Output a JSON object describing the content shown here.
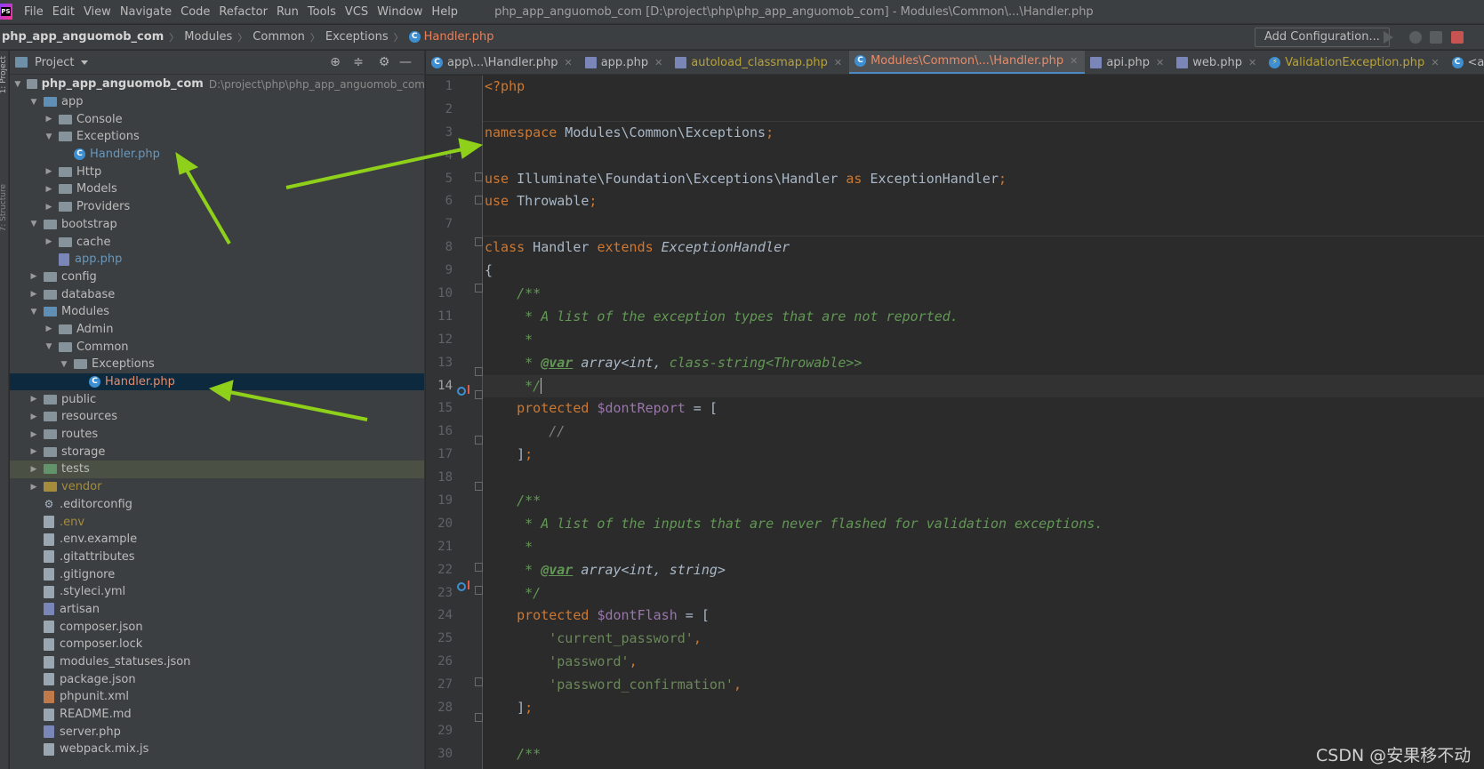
{
  "menubar": {
    "logo_text": "PS",
    "items": [
      "File",
      "Edit",
      "View",
      "Navigate",
      "Code",
      "Refactor",
      "Run",
      "Tools",
      "VCS",
      "Window",
      "Help"
    ],
    "window_title": "php_app_anguomob_com [D:\\project\\php\\php_app_anguomob_com] - Modules\\Common\\...\\Handler.php"
  },
  "breadcrumb": {
    "items": [
      "php_app_anguomob_com",
      "Modules",
      "Common",
      "Exceptions"
    ],
    "file": "Handler.php",
    "add_configuration": "Add Configuration..."
  },
  "toolstrip": {
    "project_label": "1: Project",
    "structure_label": "7: Structure"
  },
  "project_panel": {
    "title": "Project",
    "root_name": "php_app_anguomob_com",
    "root_path": "D:\\project\\php\\php_app_anguomob_com",
    "tree": {
      "app": "app",
      "console": "Console",
      "exceptions": "Exceptions",
      "handler_app": "Handler.php",
      "http": "Http",
      "models": "Models",
      "providers": "Providers",
      "bootstrap": "bootstrap",
      "cache": "cache",
      "app_php": "app.php",
      "config": "config",
      "database": "database",
      "modules": "Modules",
      "admin": "Admin",
      "common": "Common",
      "common_exceptions": "Exceptions",
      "handler_mod": "Handler.php",
      "public": "public",
      "resources": "resources",
      "routes": "routes",
      "storage": "storage",
      "tests": "tests",
      "vendor": "vendor",
      "editorconfig": ".editorconfig",
      "env": ".env",
      "env_example": ".env.example",
      "gitattributes": ".gitattributes",
      "gitignore": ".gitignore",
      "styleci": ".styleci.yml",
      "artisan": "artisan",
      "composer_json": "composer.json",
      "composer_lock": "composer.lock",
      "modules_statuses": "modules_statuses.json",
      "package_json": "package.json",
      "phpunit": "phpunit.xml",
      "readme": "README.md",
      "server": "server.php",
      "webpack": "webpack.mix.js"
    }
  },
  "tabs": [
    {
      "label": "app\\...\\Handler.php"
    },
    {
      "label": "app.php"
    },
    {
      "label": "autoload_classmap.php"
    },
    {
      "label": "Modules\\Common\\...\\Handler.php"
    },
    {
      "label": "api.php"
    },
    {
      "label": "web.php"
    },
    {
      "label": "ValidationException.php"
    },
    {
      "label": "<app_anguo"
    }
  ],
  "editor": {
    "line_numbers": [
      "1",
      "2",
      "3",
      "4",
      "5",
      "6",
      "7",
      "8",
      "9",
      "10",
      "11",
      "12",
      "13",
      "14",
      "15",
      "16",
      "17",
      "18",
      "19",
      "20",
      "21",
      "22",
      "23",
      "24",
      "25",
      "26",
      "27",
      "28",
      "29",
      "30"
    ],
    "code": {
      "l1": "<?php",
      "l3_kw": "namespace",
      "l3_ns": " Modules\\Common\\Exceptions",
      "l3_semi": ";",
      "l5_kw": "use",
      "l5_ns": " Illuminate\\Foundation\\Exceptions\\Handler ",
      "l5_as": "as",
      "l5_alias": " ExceptionHandler",
      "l5_semi": ";",
      "l6_kw": "use",
      "l6_ns": " Throwable",
      "l6_semi": ";",
      "l8_class": "class",
      "l8_name": " Handler ",
      "l8_extends": "extends",
      "l8_parent": " ExceptionHandler",
      "l9": "{",
      "l10": "    /**",
      "l11": "     * A list of the exception types that are not reported.",
      "l12": "     *",
      "l13_pre": "     * ",
      "l13_tag": "@var",
      "l13_t1": " array<int, ",
      "l13_t2": "class-string",
      "l13_t3": "<Throwable>>",
      "l14": "     */",
      "l15_kw": "    protected ",
      "l15_var": "$dontReport",
      "l15_rest": " = [",
      "l16": "        //",
      "l17_a": "    ]",
      "l17_b": ";",
      "l19": "    /**",
      "l20": "     * A list of the inputs that are never flashed for validation exceptions.",
      "l21": "     *",
      "l22_pre": "     * ",
      "l22_tag": "@var",
      "l22_t": " array<int, string>",
      "l23": "     */",
      "l24_kw": "    protected ",
      "l24_var": "$dontFlash",
      "l24_rest": " = [",
      "l25_pre": "        ",
      "l25_s": "'current_password'",
      "l25_c": ",",
      "l26_s": "'password'",
      "l26_c": ",",
      "l27_s": "'password_confirmation'",
      "l27_c": ",",
      "l28_a": "    ]",
      "l28_b": ";",
      "l30": "    /**"
    }
  },
  "watermark": "CSDN @安果移不动",
  "colors": {
    "background": "#2b2b2b",
    "panel": "#3c3f41",
    "keyword": "#cc7832",
    "string": "#6a8759",
    "comment": "#629755",
    "variable": "#9876aa",
    "selection": "#0d293e",
    "arrow": "#8fd11a"
  }
}
